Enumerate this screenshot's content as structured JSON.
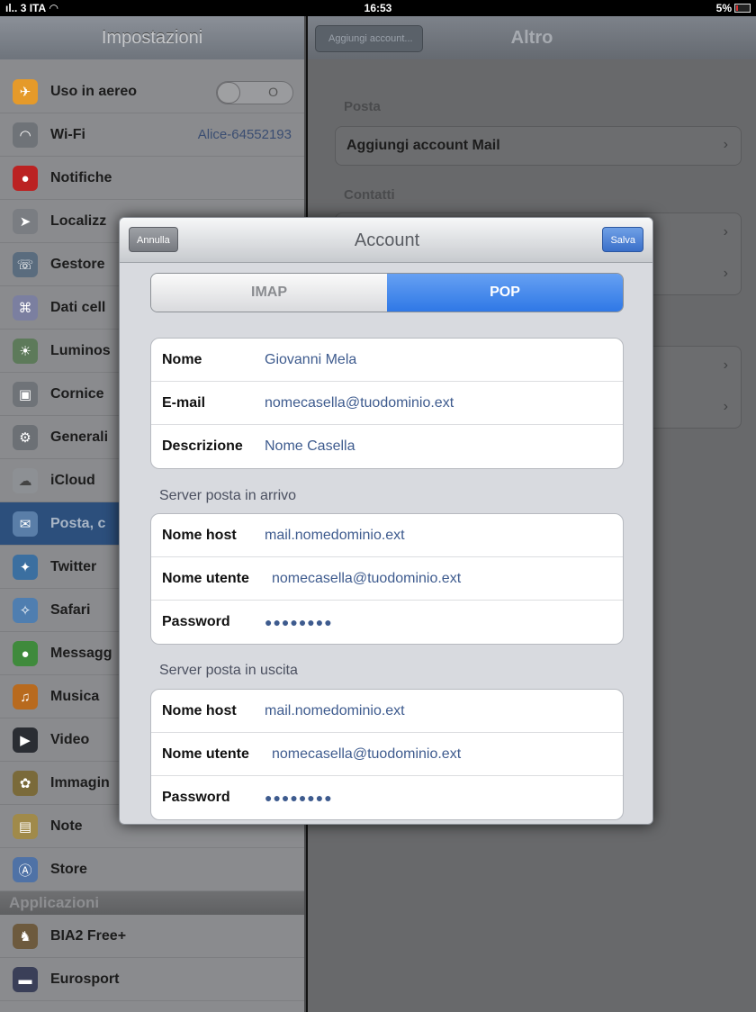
{
  "status_bar": {
    "carrier": "3 ITA",
    "time": "16:53",
    "battery": "5%"
  },
  "sidebar": {
    "title": "Impostazioni",
    "items": [
      {
        "label": "Uso in aereo",
        "icon": "airplane-icon",
        "toggle": "O"
      },
      {
        "label": "Wi-Fi",
        "icon": "wifi-icon",
        "value": "Alice-64552193"
      },
      {
        "label": "Notifiche",
        "icon": "notifications-icon"
      },
      {
        "label": "Localizz",
        "icon": "location-icon"
      },
      {
        "label": "Gestore",
        "icon": "carrier-icon"
      },
      {
        "label": "Dati cell",
        "icon": "cellular-icon"
      },
      {
        "label": "Luminos",
        "icon": "brightness-icon"
      },
      {
        "label": "Cornice",
        "icon": "picture-frame-icon"
      },
      {
        "label": "Generali",
        "icon": "gear-icon"
      },
      {
        "label": "iCloud",
        "icon": "cloud-icon"
      },
      {
        "label": "Posta, c",
        "icon": "mail-icon",
        "selected": true
      },
      {
        "label": "Twitter",
        "icon": "twitter-icon"
      },
      {
        "label": "Safari",
        "icon": "safari-icon"
      },
      {
        "label": "Messagg",
        "icon": "messages-icon"
      },
      {
        "label": "Musica",
        "icon": "music-icon"
      },
      {
        "label": "Video",
        "icon": "video-icon"
      },
      {
        "label": "Immagin",
        "icon": "photos-icon"
      },
      {
        "label": "Note",
        "icon": "notes-icon"
      },
      {
        "label": "Store",
        "icon": "store-icon"
      }
    ],
    "apps_header": "Applicazioni",
    "apps": [
      {
        "label": "BIA2 Free+",
        "icon": "bia2-app-icon"
      },
      {
        "label": "Eurosport",
        "icon": "eurosport-app-icon"
      }
    ]
  },
  "detail": {
    "back": "Aggiungi account...",
    "title": "Altro",
    "posta_label": "Posta",
    "add_mail_account": "Aggiungi account Mail",
    "contatti_label": "Contatti"
  },
  "modal": {
    "title": "Account",
    "cancel": "Annulla",
    "save": "Salva",
    "tabs": {
      "imap": "IMAP",
      "pop": "POP",
      "selected": "POP"
    },
    "account": {
      "name_label": "Nome",
      "name_value": "Giovanni Mela",
      "email_label": "E-mail",
      "email_value": "nomecasella@tuodominio.ext",
      "desc_label": "Descrizione",
      "desc_value": "Nome Casella"
    },
    "incoming": {
      "header": "Server posta in arrivo",
      "host_label": "Nome host",
      "host_value": "mail.nomedominio.ext",
      "user_label": "Nome utente",
      "user_value": "nomecasella@tuodominio.ext",
      "pass_label": "Password",
      "pass_value": "●●●●●●●●"
    },
    "outgoing": {
      "header": "Server posta in uscita",
      "host_label": "Nome host",
      "host_value": "mail.nomedominio.ext",
      "user_label": "Nome utente",
      "user_value": "nomecasella@tuodominio.ext",
      "pass_label": "Password",
      "pass_value": "●●●●●●●●"
    }
  },
  "colors": {
    "accent": "#2f78e6",
    "value_text": "#3e5b8e",
    "selected_row": "#2c4f7c"
  }
}
